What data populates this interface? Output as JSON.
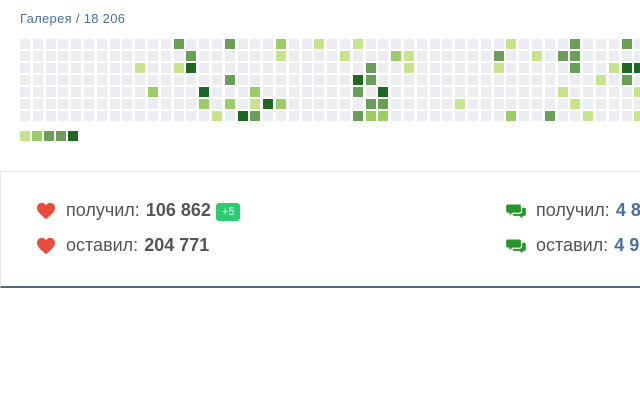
{
  "header": {
    "gallery_link": "Галерея / 18 206"
  },
  "heatmap": {
    "colors": {
      "empty": "#ebedf0",
      "level1": "#c6e48b",
      "level2": "#9ccc65",
      "level3": "#6a9f58",
      "level4": "#1e6823"
    },
    "active_cells": [
      [
        0,
        12,
        3
      ],
      [
        0,
        16,
        3
      ],
      [
        0,
        20,
        2
      ],
      [
        0,
        23,
        1
      ],
      [
        0,
        26,
        1
      ],
      [
        0,
        38,
        1
      ],
      [
        0,
        43,
        3
      ],
      [
        0,
        47,
        3
      ],
      [
        1,
        13,
        3
      ],
      [
        1,
        20,
        1
      ],
      [
        1,
        25,
        1
      ],
      [
        1,
        29,
        2
      ],
      [
        1,
        30,
        1
      ],
      [
        1,
        37,
        3
      ],
      [
        1,
        40,
        1
      ],
      [
        1,
        42,
        3
      ],
      [
        1,
        43,
        3
      ],
      [
        2,
        9,
        1
      ],
      [
        2,
        12,
        1
      ],
      [
        2,
        13,
        4
      ],
      [
        2,
        27,
        3
      ],
      [
        2,
        30,
        1
      ],
      [
        2,
        37,
        1
      ],
      [
        2,
        43,
        3
      ],
      [
        2,
        46,
        1
      ],
      [
        2,
        47,
        4
      ],
      [
        2,
        48,
        4
      ],
      [
        3,
        16,
        3
      ],
      [
        3,
        26,
        4
      ],
      [
        3,
        27,
        3
      ],
      [
        3,
        45,
        1
      ],
      [
        3,
        47,
        3
      ],
      [
        4,
        10,
        2
      ],
      [
        4,
        14,
        4
      ],
      [
        4,
        18,
        2
      ],
      [
        4,
        26,
        3
      ],
      [
        4,
        28,
        4
      ],
      [
        4,
        42,
        1
      ],
      [
        4,
        48,
        1
      ],
      [
        5,
        14,
        2
      ],
      [
        5,
        16,
        2
      ],
      [
        5,
        18,
        1
      ],
      [
        5,
        19,
        4
      ],
      [
        5,
        20,
        2
      ],
      [
        5,
        27,
        3
      ],
      [
        5,
        28,
        3
      ],
      [
        5,
        34,
        1
      ],
      [
        5,
        43,
        1
      ],
      [
        6,
        15,
        1
      ],
      [
        6,
        17,
        4
      ],
      [
        6,
        18,
        3
      ],
      [
        6,
        26,
        3
      ],
      [
        6,
        27,
        2
      ],
      [
        6,
        28,
        2
      ],
      [
        6,
        38,
        2
      ],
      [
        6,
        41,
        3
      ],
      [
        6,
        44,
        1
      ],
      [
        6,
        48,
        1
      ]
    ],
    "legend": [
      "level1",
      "level2",
      "level3",
      "level3",
      "level4"
    ]
  },
  "stats": {
    "likes_received_label": "получил:",
    "likes_received_value": "106 862",
    "likes_received_badge": "+5",
    "likes_given_label": "оставил:",
    "likes_given_value": "204 771",
    "comments_received_label": "получил:",
    "comments_received_value": "4 8",
    "comments_given_label": "оставил:",
    "comments_given_value": "4 9"
  },
  "colors": {
    "heart": "#e74c3c",
    "comment": "#27952b",
    "link": "#4a6fa5",
    "badge": "#2ecc71",
    "panel_border": "#4c6a8c"
  }
}
